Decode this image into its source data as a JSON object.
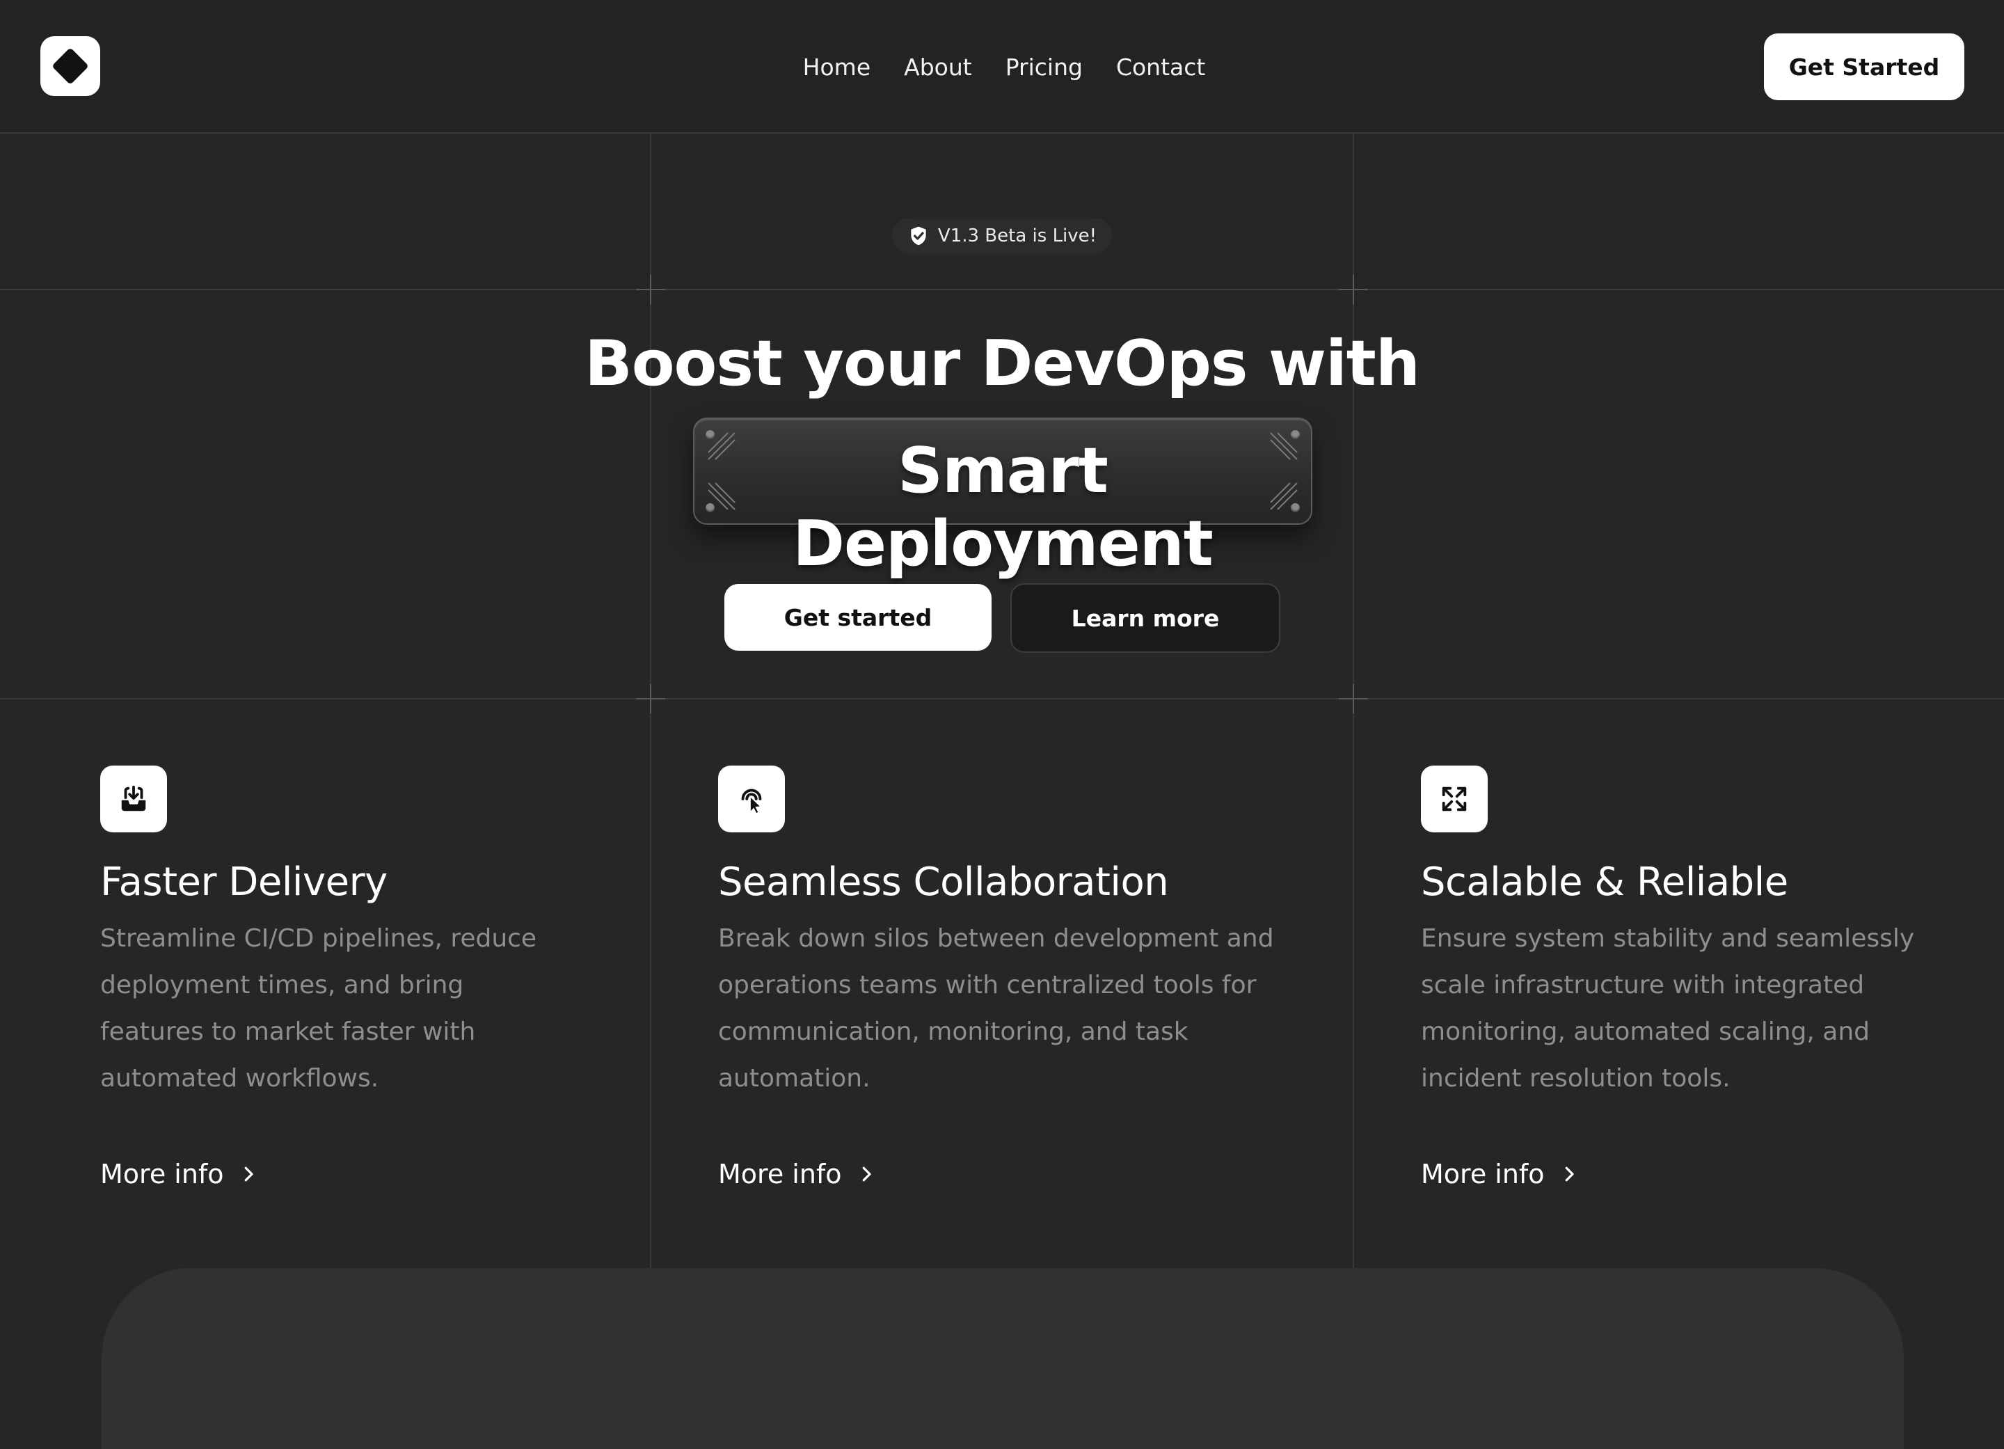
{
  "colors": {
    "background": "#262626",
    "topbar": "#232323",
    "accent": "#ffffff",
    "muted_text": "#8e8e8e"
  },
  "header": {
    "logo_icon": "diamond-logo",
    "nav": [
      "Home",
      "About",
      "Pricing",
      "Contact"
    ],
    "cta_label": "Get Started"
  },
  "hero": {
    "badge_icon": "shield-check-icon",
    "badge_text": "V1.3 Beta is Live!",
    "headline": "Boost your DevOps with",
    "highlight": "Smart Deployment",
    "primary_cta": "Get started",
    "secondary_cta": "Learn more"
  },
  "features": [
    {
      "icon": "inbox-download-icon",
      "title": "Faster Delivery",
      "description": "Streamline CI/CD pipelines, reduce deployment times, and bring features to market faster with automated workflows.",
      "link": "More info"
    },
    {
      "icon": "pointer-click-icon",
      "title": "Seamless Collaboration",
      "description": "Break down silos between development and operations teams with centralized tools for communication, monitoring, and task automation.",
      "link": "More info"
    },
    {
      "icon": "expand-arrows-icon",
      "title": "Scalable & Reliable",
      "description": "Ensure system stability and seamlessly scale infrastructure with integrated monitoring, automated scaling, and incident resolution tools.",
      "link": "More info"
    }
  ]
}
